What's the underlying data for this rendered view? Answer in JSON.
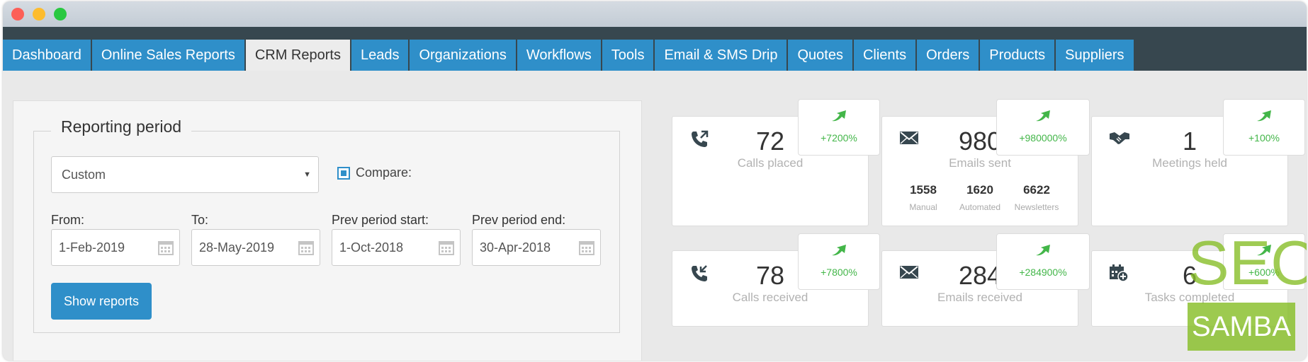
{
  "nav": {
    "tabs": [
      "Dashboard",
      "Online Sales Reports",
      "CRM Reports",
      "Leads",
      "Organizations",
      "Workflows",
      "Tools",
      "Email & SMS Drip",
      "Quotes",
      "Clients",
      "Orders",
      "Products",
      "Suppliers"
    ],
    "active_tab": "CRM Reports"
  },
  "reporting": {
    "legend": "Reporting period",
    "period_select": "Custom",
    "compare_label": "Compare:",
    "compare_checked": true,
    "from_label": "From:",
    "from_value": "1-Feb-2019",
    "to_label": "To:",
    "to_value": "28-May-2019",
    "prev_start_label": "Prev period start:",
    "prev_start_value": "1-Oct-2018",
    "prev_end_label": "Prev period end:",
    "prev_end_value": "30-Apr-2018",
    "show_button": "Show reports"
  },
  "stats": {
    "calls_placed": {
      "value": "72",
      "label": "Calls placed",
      "change": "+7200%"
    },
    "emails_sent": {
      "value": "980",
      "label": "Emails sent",
      "change": "+980000%",
      "manual": "1558",
      "manual_label": "Manual",
      "automated": "1620",
      "automated_label": "Automated",
      "newsletters": "6622",
      "newsletters_label": "Newsletters"
    },
    "meetings_held": {
      "value": "1",
      "label": "Meetings held",
      "change": "+100%"
    },
    "calls_received": {
      "value": "78",
      "label": "Calls received",
      "change": "+7800%"
    },
    "emails_received": {
      "value": "284",
      "label": "Emails received",
      "change": "+284900%"
    },
    "tasks_completed": {
      "value": "6",
      "label": "Tasks completed",
      "change": "+600%"
    }
  },
  "watermark": {
    "top": "SEO",
    "bottom": "SAMBA"
  },
  "colors": {
    "accent": "#2f8fc9",
    "navbar": "#37474f",
    "trend_up": "#43b649",
    "watermark": "#87be28"
  },
  "icons": [
    "phone-outgoing-icon",
    "envelope-icon",
    "handshake-icon",
    "phone-incoming-icon",
    "calendar-plus-icon",
    "calendar-icon",
    "trend-up-arrow-icon",
    "caret-down-icon"
  ]
}
